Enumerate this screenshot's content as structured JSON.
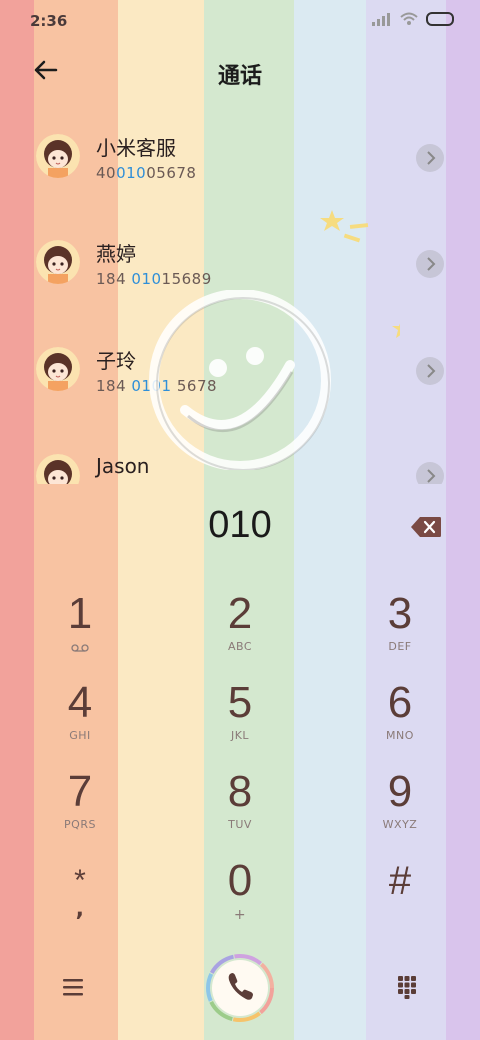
{
  "status": {
    "time": "2:36"
  },
  "header": {
    "title": "通话"
  },
  "contacts": [
    {
      "name": "小米客服",
      "num_a": "40",
      "num_hl": "010",
      "num_b": "05678"
    },
    {
      "name": "燕婷",
      "num_a": "184 ",
      "num_hl": "010",
      "num_b": "15689"
    },
    {
      "name": "子玲",
      "num_a": "184 ",
      "num_hl": "0101",
      "num_b": " 5678"
    },
    {
      "name": "Jason",
      "num_a": "",
      "num_hl": "",
      "num_b": ""
    }
  ],
  "dial": {
    "value": "010"
  },
  "keypad": [
    {
      "digit": "1",
      "sub": ""
    },
    {
      "digit": "2",
      "sub": "ABC"
    },
    {
      "digit": "3",
      "sub": "DEF"
    },
    {
      "digit": "4",
      "sub": "GHI"
    },
    {
      "digit": "5",
      "sub": "JKL"
    },
    {
      "digit": "6",
      "sub": "MNO"
    },
    {
      "digit": "7",
      "sub": "PQRS"
    },
    {
      "digit": "8",
      "sub": "TUV"
    },
    {
      "digit": "9",
      "sub": "WXYZ"
    },
    {
      "digit": "*",
      "sub": ","
    },
    {
      "digit": "0",
      "sub": "+"
    },
    {
      "digit": "#",
      "sub": ""
    }
  ],
  "colors": {
    "stripes": [
      "#f2a29b",
      "#f8c3a2",
      "#fbe9c3",
      "#d4e8cf",
      "#dbeaf2",
      "#dcdaf2",
      "#d9c4ec"
    ],
    "highlight": "#2f8fd8",
    "key_text": "#5b3d38"
  }
}
